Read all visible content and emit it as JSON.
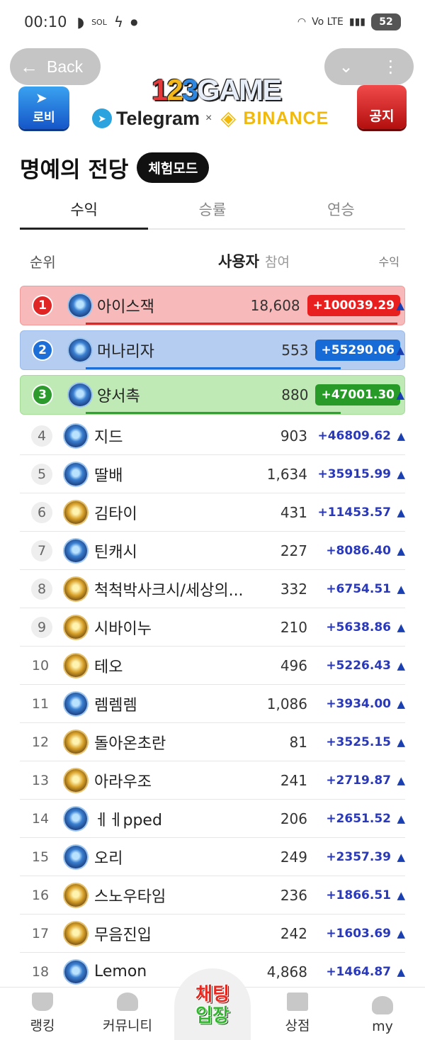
{
  "status_bar": {
    "time": "00:10",
    "carrier": "신한 SOL Bank",
    "network": "Vo LTE",
    "battery": "52"
  },
  "header": {
    "back_label": "Back",
    "lobby_label": "로비",
    "notice_label": "공지",
    "brand": "123GAME",
    "telegram_label": "Telegram",
    "separator": "×",
    "binance_label": "BINANCE"
  },
  "page": {
    "title": "명예의 전당",
    "mode_badge": "체험모드"
  },
  "tabs": [
    {
      "label": "수익",
      "active": true
    },
    {
      "label": "승률",
      "active": false
    },
    {
      "label": "연승",
      "active": false
    }
  ],
  "columns": {
    "rank": "순위",
    "user": "사용자",
    "participation": "참여",
    "profit": "수익"
  },
  "top3": [
    {
      "rank": "1",
      "name": "아이스잭",
      "count": "18,608",
      "profit": "+100039.29",
      "avatar": "blue"
    },
    {
      "rank": "2",
      "name": "머나리자",
      "count": "553",
      "profit": "+55290.06",
      "avatar": "blue"
    },
    {
      "rank": "3",
      "name": "양서촉",
      "count": "880",
      "profit": "+47001.30",
      "avatar": "blue"
    }
  ],
  "rows": [
    {
      "rank": "4",
      "name": "지드",
      "count": "903",
      "profit": "+46809.62",
      "avatar": "blue"
    },
    {
      "rank": "5",
      "name": "딸배",
      "count": "1,634",
      "profit": "+35915.99",
      "avatar": "blue"
    },
    {
      "rank": "6",
      "name": "김타이",
      "count": "431",
      "profit": "+11453.57",
      "avatar": "gold"
    },
    {
      "rank": "7",
      "name": "틴캐시",
      "count": "227",
      "profit": "+8086.40",
      "avatar": "blue"
    },
    {
      "rank": "8",
      "name": "척척박사크시/세상의...",
      "count": "332",
      "profit": "+6754.51",
      "avatar": "gold"
    },
    {
      "rank": "9",
      "name": "시바이누",
      "count": "210",
      "profit": "+5638.86",
      "avatar": "gold"
    },
    {
      "rank": "10",
      "name": "테오",
      "count": "496",
      "profit": "+5226.43",
      "avatar": "gold"
    },
    {
      "rank": "11",
      "name": "렘렘렘",
      "count": "1,086",
      "profit": "+3934.00",
      "avatar": "blue"
    },
    {
      "rank": "12",
      "name": "돌아온초란",
      "count": "81",
      "profit": "+3525.15",
      "avatar": "gold"
    },
    {
      "rank": "13",
      "name": "아라우조",
      "count": "241",
      "profit": "+2719.87",
      "avatar": "gold"
    },
    {
      "rank": "14",
      "name": "ㅔㅔpped",
      "count": "206",
      "profit": "+2651.52",
      "avatar": "blue"
    },
    {
      "rank": "15",
      "name": "오리",
      "count": "249",
      "profit": "+2357.39",
      "avatar": "blue"
    },
    {
      "rank": "16",
      "name": "스노우타임",
      "count": "236",
      "profit": "+1866.51",
      "avatar": "gold"
    },
    {
      "rank": "17",
      "name": "무음진입",
      "count": "242",
      "profit": "+1603.69",
      "avatar": "gold"
    },
    {
      "rank": "18",
      "name": "Lemon",
      "count": "4,868",
      "profit": "+1464.87",
      "avatar": "blue"
    }
  ],
  "up_arrow": "▲",
  "bottom_nav": {
    "ranking": "랭킹",
    "community": "커뮤니티",
    "chat_line1": "채팅",
    "chat_line2": "입장",
    "shop": "상점",
    "my": "my"
  }
}
